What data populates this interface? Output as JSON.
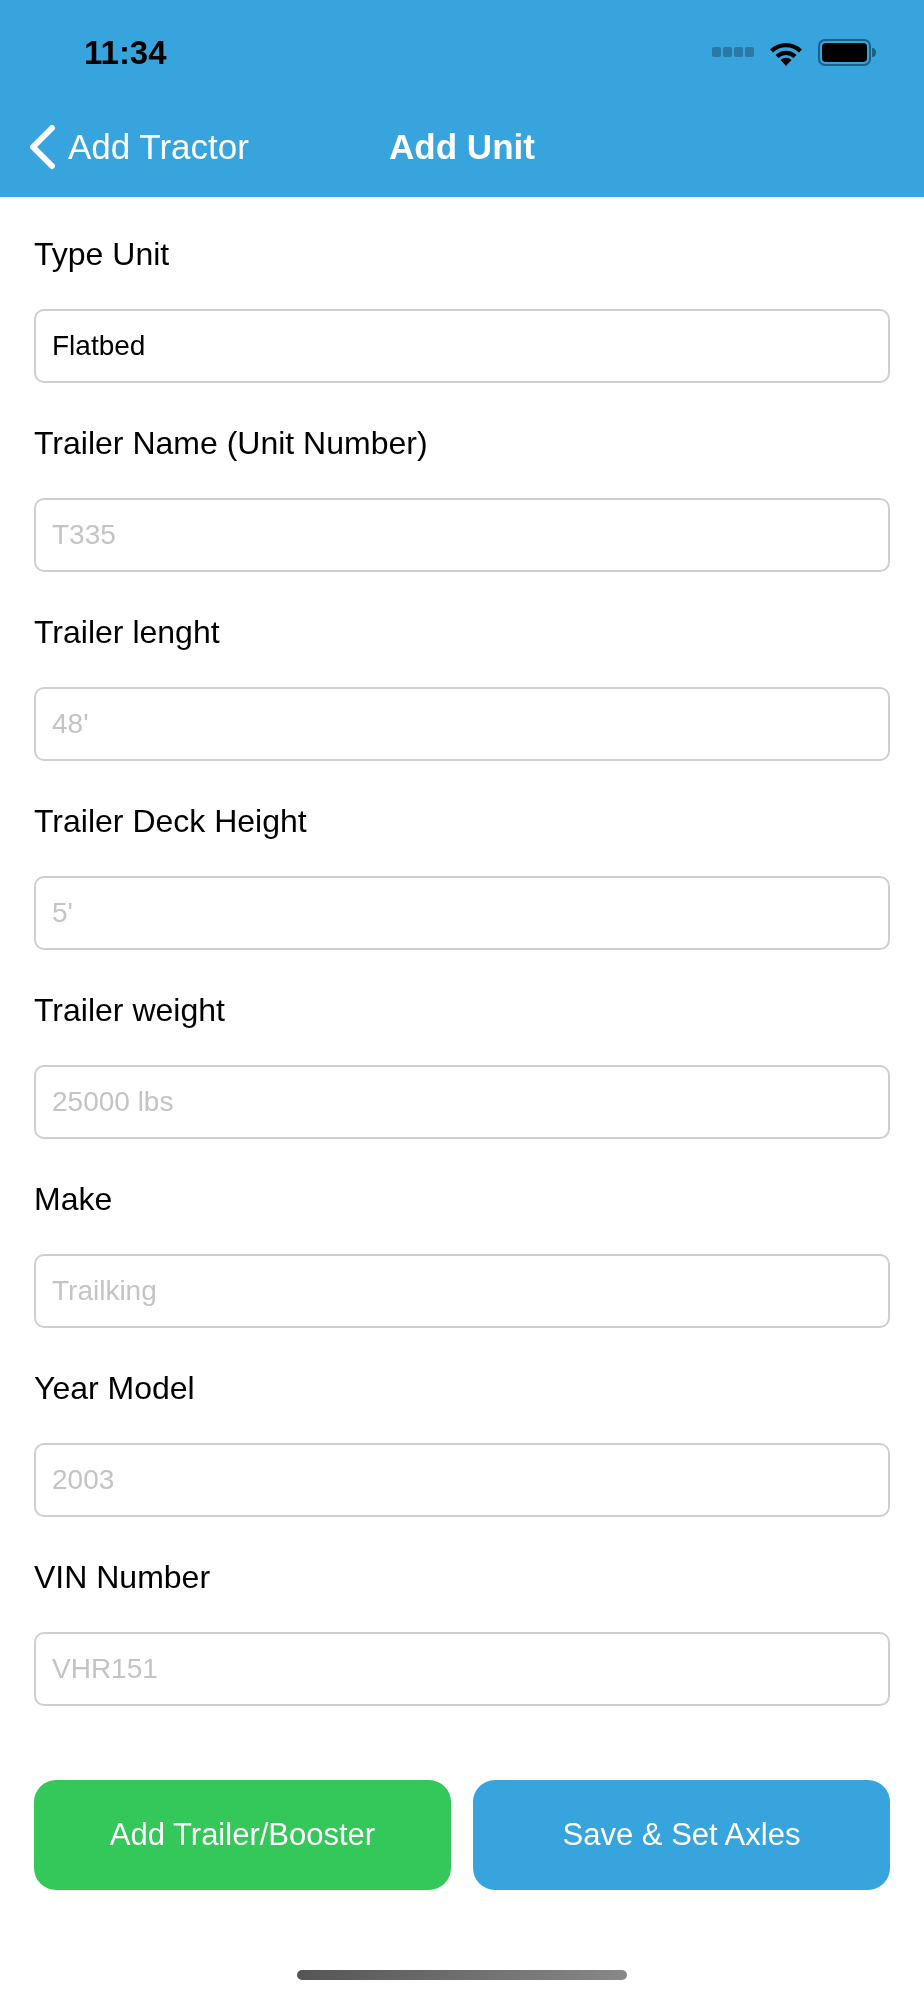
{
  "status_bar": {
    "time": "11:34"
  },
  "nav": {
    "back_label": "Add Tractor",
    "title": "Add Unit"
  },
  "fields": [
    {
      "label": "Type Unit",
      "value": "Flatbed"
    },
    {
      "label": "Trailer Name (Unit Number)",
      "placeholder": "T335"
    },
    {
      "label": "Trailer lenght",
      "placeholder": "48'"
    },
    {
      "label": "Trailer Deck Height",
      "placeholder": "5'"
    },
    {
      "label": "Trailer weight",
      "placeholder": "25000 lbs"
    },
    {
      "label": "Make",
      "placeholder": "Trailking"
    },
    {
      "label": "Year Model",
      "placeholder": "2003"
    },
    {
      "label": "VIN Number",
      "placeholder": "VHR151"
    }
  ],
  "buttons": [
    {
      "label": "Add Trailer/Booster",
      "color": "#34c759"
    },
    {
      "label": "Save & Set Axles",
      "color": "#38a4dd"
    }
  ]
}
